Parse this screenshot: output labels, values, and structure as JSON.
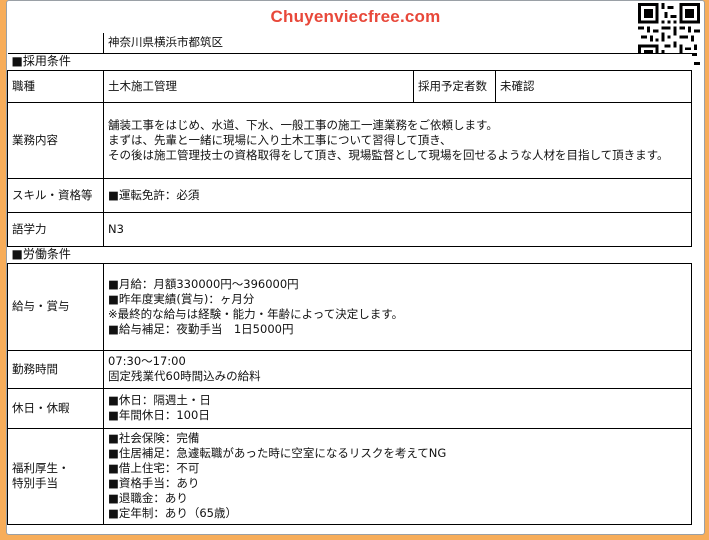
{
  "header": {
    "brand": "Chuyenviecfree.com"
  },
  "location": {
    "value": "神奈川県横浜市都筑区"
  },
  "sections": {
    "hiring": "■採用条件",
    "labor": "■労働条件"
  },
  "hiring": {
    "job_type_label": "職種",
    "job_type_value": "土木施工管理",
    "headcount_label": "採用予定者数",
    "headcount_value": "未確認",
    "duties_label": "業務内容",
    "duties_value": "舗装工事をはじめ、水道、下水、一般工事の施工一連業務をご依頼します。\nまずは、先輩と一緒に現場に入り土木工事について習得して頂き、\nその後は施工管理技士の資格取得をして頂き、現場監督として現場を回せるような人材を目指して頂きます。",
    "skills_label": "スキル・資格等",
    "skills_value": "■運転免許：必須",
    "language_label": "語学力",
    "language_value": "N3"
  },
  "labor": {
    "salary_label": "給与・賞与",
    "salary_value": "■月給：月額330000円～396000円\n■昨年度実績(賞与)：ヶ月分\n※最終的な給与は経験・能力・年齢によって決定します。\n■給与補足：夜勤手当　1日5000円",
    "hours_label": "勤務時間",
    "hours_value": "07:30～17:00\n固定残業代60時間込みの給料",
    "holidays_label": "休日・休暇",
    "holidays_value": "■休日：隔週土・日\n■年間休日：100日",
    "welfare_label": "福利厚生・\n特別手当",
    "welfare_value": "■社会保険：完備\n■住居補足：急遽転職があった時に空室になるリスクを考えてNG\n■借上住宅：不可\n■資格手当：あり\n■退職金：あり\n■定年制：あり（65歳）"
  }
}
